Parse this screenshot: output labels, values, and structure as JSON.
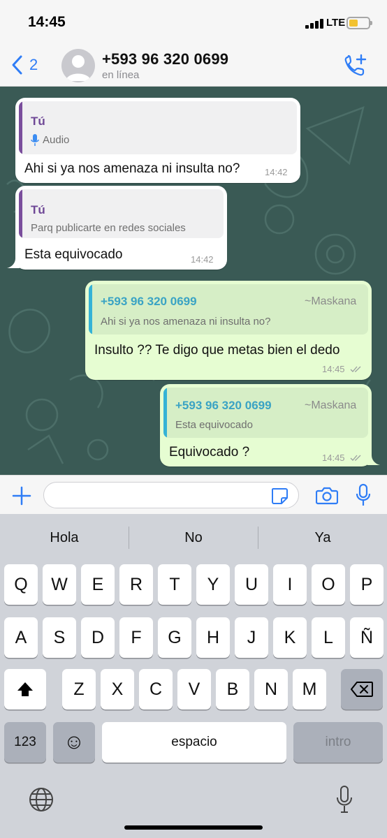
{
  "status_bar": {
    "time": "14:45",
    "network": "LTE",
    "battery_level": 0.45
  },
  "header": {
    "back_count": "2",
    "contact_name": "+593 96 320 0699",
    "contact_status": "en línea"
  },
  "messages": [
    {
      "direction": "incoming",
      "quote_author": "Tú",
      "quote_text": "Audio",
      "text": "Ahi si ya nos amenaza ni insulta no?",
      "time": "14:42"
    },
    {
      "direction": "incoming",
      "quote_author": "Tú",
      "quote_text": "Parq publicarte en redes sociales",
      "text": "Esta equivocado",
      "time": "14:42"
    },
    {
      "direction": "outgoing",
      "quote_author": "+593 96 320 0699",
      "quote_sender": "~Maskana",
      "quote_text": "Ahi si ya nos amenaza ni insulta no?",
      "text": "Insulto ?? Te digo que metas bien el dedo",
      "time": "14:45"
    },
    {
      "direction": "outgoing",
      "quote_author": "+593 96 320 0699",
      "quote_sender": "~Maskana",
      "quote_text": "Esta equivocado",
      "text": "Equivocado ?",
      "time": "14:45"
    }
  ],
  "input": {
    "value": "",
    "placeholder": ""
  },
  "keyboard": {
    "suggestions": [
      "Hola",
      "No",
      "Ya"
    ],
    "row1": [
      "Q",
      "W",
      "E",
      "R",
      "T",
      "Y",
      "U",
      "I",
      "O",
      "P"
    ],
    "row2": [
      "A",
      "S",
      "D",
      "F",
      "G",
      "H",
      "J",
      "K",
      "L",
      "Ñ"
    ],
    "row3": [
      "Z",
      "X",
      "C",
      "V",
      "B",
      "N",
      "M"
    ],
    "numbers_key": "123",
    "emoji_key": "☺",
    "space_key": "espacio",
    "return_key": "intro"
  },
  "colors": {
    "accent_blue": "#2f7df6",
    "chat_bg": "#3a5a55",
    "outgoing_bubble": "#e6fdd2",
    "incoming_bubble": "#ffffff",
    "quote_purple": "#6e4796",
    "quote_teal": "#3aa3c4"
  },
  "icons": [
    "back-chevron-icon",
    "avatar-placeholder-icon",
    "add-call-icon",
    "plus-icon",
    "sticker-icon",
    "camera-icon",
    "microphone-icon",
    "shift-icon",
    "backspace-icon",
    "globe-icon",
    "read-ticks-icon"
  ]
}
